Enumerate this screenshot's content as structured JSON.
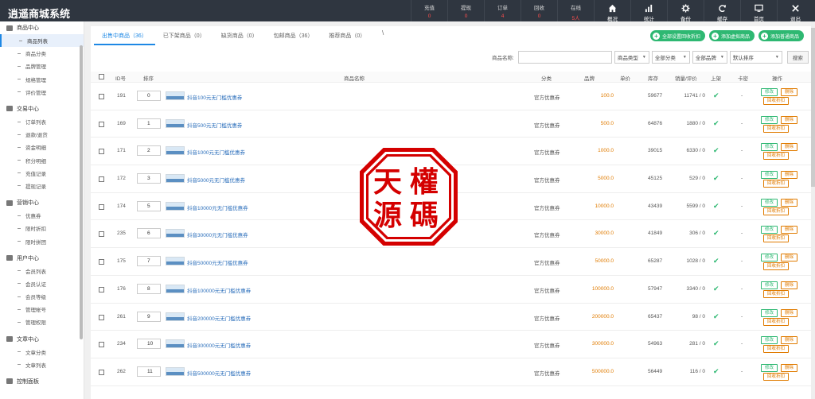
{
  "app": {
    "title": "逍遥商城系统"
  },
  "stats": [
    {
      "label": "充值",
      "value": "0"
    },
    {
      "label": "提现",
      "value": "0"
    },
    {
      "label": "订单",
      "value": "4"
    },
    {
      "label": "回收",
      "value": "0"
    },
    {
      "label": "在线",
      "value": "5人"
    }
  ],
  "nav": [
    {
      "label": "概况",
      "icon": "home-icon"
    },
    {
      "label": "统计",
      "icon": "bar-chart-icon"
    },
    {
      "label": "备份",
      "icon": "gear-icon"
    },
    {
      "label": "缓存",
      "icon": "refresh-icon"
    },
    {
      "label": "首页",
      "icon": "monitor-icon"
    },
    {
      "label": "退出",
      "icon": "close-icon"
    }
  ],
  "sidebar": [
    {
      "group": "商品中心",
      "items": [
        "商品列表",
        "商品分类",
        "品牌管理",
        "规格管理",
        "评价管理"
      ]
    },
    {
      "group": "交易中心",
      "items": [
        "订单列表",
        "退款/退货",
        "资金明细",
        "积分明细",
        "充值记录",
        "提现记录"
      ]
    },
    {
      "group": "营销中心",
      "items": [
        "优惠券",
        "限时折扣",
        "限时拼团"
      ]
    },
    {
      "group": "用户中心",
      "items": [
        "会员列表",
        "会员认证",
        "会员等级",
        "管理帐号",
        "管理权限"
      ]
    },
    {
      "group": "文章中心",
      "items": [
        "文章分类",
        "文章列表"
      ]
    },
    {
      "group": "控制面板",
      "items": []
    }
  ],
  "tabs": [
    {
      "label": "出售中商品（36）"
    },
    {
      "label": "已下架商品（0）"
    },
    {
      "label": "缺货商品（0）"
    },
    {
      "label": "包邮商品（36）"
    },
    {
      "label": "推荐商品（0）"
    }
  ],
  "tab_extra": "\\",
  "actions": [
    "全部设置回收折扣",
    "添加虚拟商品",
    "添加普通商品"
  ],
  "filter": {
    "name_label": "商品名称:",
    "type": "商品类型",
    "category": "全部分类",
    "brand": "全部品牌",
    "sort": "默认排序",
    "search": "搜索"
  },
  "table": {
    "headers": [
      "ID号",
      "排序",
      "商品名称",
      "分类",
      "品牌",
      "单价",
      "库存",
      "销量/评价",
      "上架",
      "卡密",
      "操作"
    ],
    "category_value": "官方优惠券",
    "kami_value": "-",
    "op_labels": {
      "edit": "修改",
      "del": "删除",
      "recycle": "回收折扣"
    },
    "rows": [
      {
        "id": "191",
        "sort": "0",
        "name": "抖音100元无门槛优惠券",
        "price": "100.0",
        "stock": "59677",
        "sales": "11741 / 0"
      },
      {
        "id": "169",
        "sort": "1",
        "name": "抖音500元无门槛优惠券",
        "price": "500.0",
        "stock": "64876",
        "sales": "1880 / 0"
      },
      {
        "id": "171",
        "sort": "2",
        "name": "抖音1000元无门槛优惠券",
        "price": "1000.0",
        "stock": "39015",
        "sales": "6330 / 0"
      },
      {
        "id": "172",
        "sort": "3",
        "name": "抖音5000元无门槛优惠券",
        "price": "5000.0",
        "stock": "45125",
        "sales": "529 / 0"
      },
      {
        "id": "174",
        "sort": "5",
        "name": "抖音10000元无门槛优惠券",
        "price": "10000.0",
        "stock": "43439",
        "sales": "5599 / 0"
      },
      {
        "id": "235",
        "sort": "6",
        "name": "抖音30000元无门槛优惠券",
        "price": "30000.0",
        "stock": "41849",
        "sales": "306 / 0"
      },
      {
        "id": "175",
        "sort": "7",
        "name": "抖音50000元无门槛优惠券",
        "price": "50000.0",
        "stock": "65287",
        "sales": "1028 / 0"
      },
      {
        "id": "176",
        "sort": "8",
        "name": "抖音100000元无门槛优惠券",
        "price": "100000.0",
        "stock": "57947",
        "sales": "3340 / 0"
      },
      {
        "id": "261",
        "sort": "9",
        "name": "抖音200000元无门槛优惠券",
        "price": "200000.0",
        "stock": "65437",
        "sales": "98 / 0"
      },
      {
        "id": "234",
        "sort": "10",
        "name": "抖音300000元无门槛优惠券",
        "price": "300000.0",
        "stock": "54963",
        "sales": "281 / 0"
      },
      {
        "id": "262",
        "sort": "11",
        "name": "抖音500000元无门槛优惠券",
        "price": "500000.0",
        "stock": "56449",
        "sales": "116 / 0"
      }
    ]
  },
  "stamp": {
    "chars": [
      "天",
      "權",
      "源",
      "碼"
    ]
  },
  "colors": {
    "accent": "#1e88e5",
    "green": "#2eb872",
    "orange": "#e07b00",
    "stamp": "#d40000",
    "topbar": "#2f3640"
  }
}
